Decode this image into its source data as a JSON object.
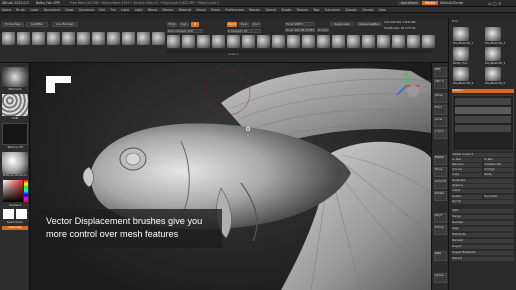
{
  "titlebar": {
    "title": "ZBrush 2022.0.5",
    "doc": "Betta_Fish.ZPR",
    "stats": "Free Mem 28.706 • Active Mem 4793 • Scratch Disk 41 • PolyCount 5.822 MP • MeshCount 1",
    "right": [
      "QuickSave",
      "Menus",
      "DefaultZScript"
    ]
  },
  "menu": {
    "items": [
      "Alpha",
      "Brush",
      "Color",
      "Document",
      "Draw",
      "Dynamics",
      "Edit",
      "File",
      "Layer",
      "Light",
      "Macro",
      "Marker",
      "Material",
      "Movie",
      "Picker",
      "Preferences",
      "Render",
      "Stencil",
      "Stroke",
      "Texture",
      "Tool",
      "Transform",
      "Zplugin",
      "Zscript",
      "Help"
    ]
  },
  "shelf": {
    "home_page": "Home Page",
    "lightbox": "LightBox",
    "live_boolean": "Live Boolean",
    "mrgb": "Mrgb",
    "rgb": "Rgb",
    "m": "M",
    "zadd": "Zadd",
    "zsub": "Zsub",
    "zcut": "Zcut",
    "rgb_intensity": "Rgb Intensity 100",
    "z_intensity": "Z Intensity 25",
    "focal_shift": "Focal Shift 0",
    "draw_size": "Draw Size 66.76387",
    "dynamic": "Dynamic",
    "replaylast": "ReplayLast",
    "replaylastrel": "ReplayLastRel",
    "activepoints": "ActivePoints: 5.822 Mil",
    "totalpoints": "TotalPoints: 16.575 Mil",
    "scale_readout": "Scale 1"
  },
  "left": {
    "brush_label": "ZRemesh",
    "brush_alpha": "VDM",
    "texture_label": "Texture Off",
    "matcap": "MatCap White 01",
    "gradient": "Gradient",
    "switch_color": "SwitchColor",
    "alternate": "Alternate"
  },
  "right": {
    "tool_label": "Tool",
    "thumbs": [
      "PolyMesh3D_1",
      "PolyMesh3D_2",
      "Betta_Fish",
      "PolyMesh3D_3",
      "PolyMesh3D_4",
      "PolyMesh3D_5"
    ],
    "subtool": "Subtool",
    "subtool_buttons": [
      "Visible Count 4",
      "Lo Res",
      "Hi Res",
      "Rename",
      "AutoReorder",
      "All Low",
      "All High",
      "Copy",
      "Paste",
      "Duplicate",
      "Append",
      "Insert",
      "Delete",
      "Del Other",
      "Del All",
      "Split",
      "Merge",
      "Boolean",
      "Align",
      "Distribute",
      "Remesh",
      "Project",
      "Project BasRelief",
      "Extract"
    ]
  },
  "sidebar": {
    "buttons": [
      "BPR",
      "SPix 3",
      "Persp",
      "Floor",
      "Local",
      "L.Sym",
      "Frame",
      "Move",
      "Zoom3D",
      "Rotate",
      "PolyF",
      "Transp",
      "Solo",
      "Xpose"
    ]
  },
  "caption": {
    "line1": "Vector Displacement brushes give you",
    "line2": "more control over mesh features"
  },
  "colors": {
    "accent": "#d86a1e",
    "bg": "#1a1a1a",
    "panel": "#2a2a2a"
  }
}
